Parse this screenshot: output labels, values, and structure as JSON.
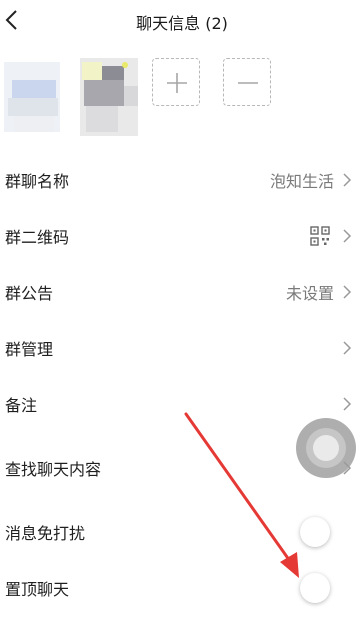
{
  "header": {
    "title": "聊天信息 (2)",
    "back_icon": "chevron-left-icon"
  },
  "members": {
    "add_icon": "plus-icon",
    "remove_icon": "minus-icon"
  },
  "settings": [
    {
      "label": "群聊名称",
      "value": "泡知生活"
    },
    {
      "label": "群二维码",
      "icon": "qr-code-icon"
    },
    {
      "label": "群公告",
      "value": "未设置"
    },
    {
      "label": "群管理"
    },
    {
      "label": "备注"
    },
    {
      "label": "查找聊天内容"
    },
    {
      "label": "消息免打扰",
      "toggle": "off"
    },
    {
      "label": "置顶聊天",
      "toggle": "off"
    }
  ],
  "colors": {
    "annotation_arrow": "#e53935",
    "text": "#1f1f1f",
    "secondary_text": "#7a7a7a"
  }
}
